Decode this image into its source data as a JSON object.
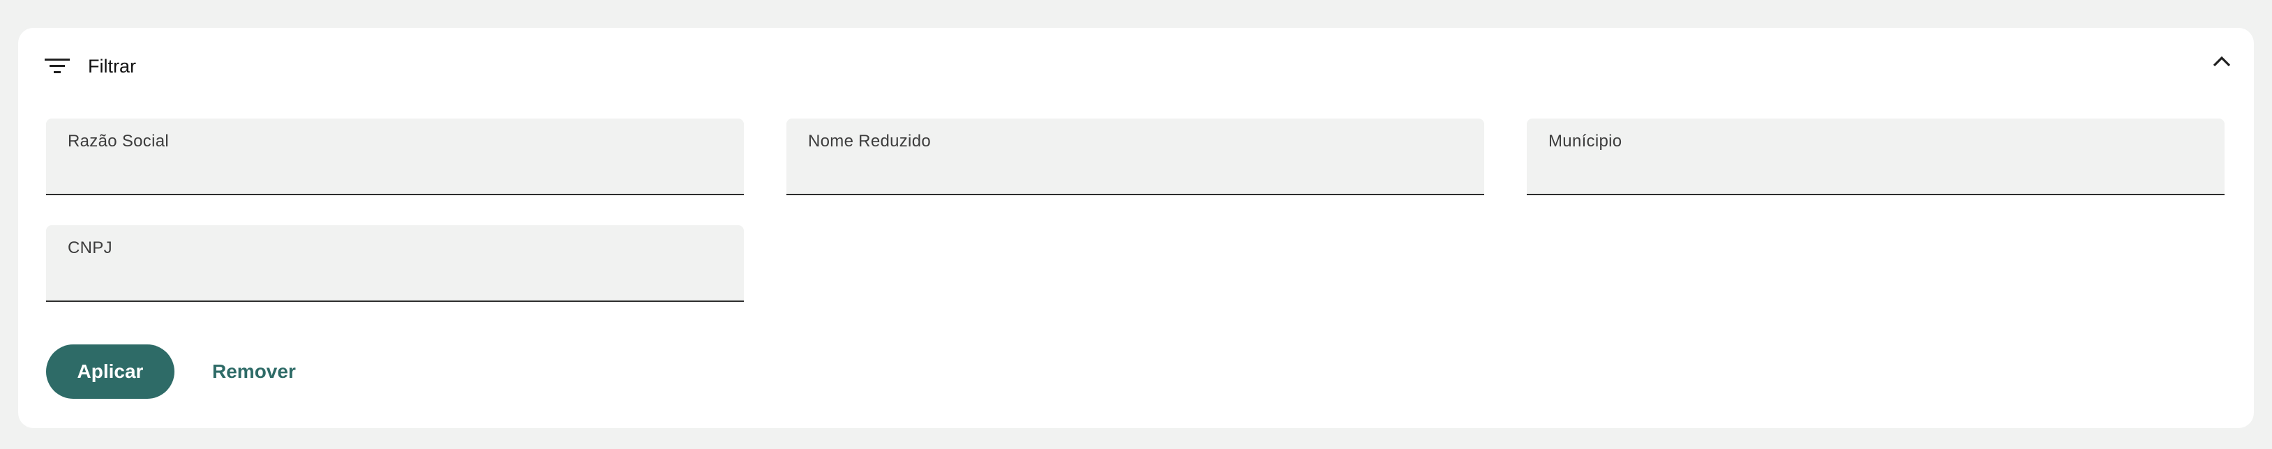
{
  "filter_panel": {
    "title": "Filtrar",
    "icons": {
      "filter": "filter-list-icon",
      "collapse": "chevron-up-icon"
    },
    "fields": [
      {
        "label": "Razão Social",
        "value": ""
      },
      {
        "label": "Nome Reduzido",
        "value": ""
      },
      {
        "label": "Munícipio",
        "value": ""
      },
      {
        "label": "CNPJ",
        "value": ""
      }
    ],
    "apply_label": "Aplicar",
    "remove_label": "Remover"
  },
  "colors": {
    "background": "#f1f2f1",
    "panel": "#ffffff",
    "field_background": "#f1f2f1",
    "accent": "#2e6b67"
  }
}
